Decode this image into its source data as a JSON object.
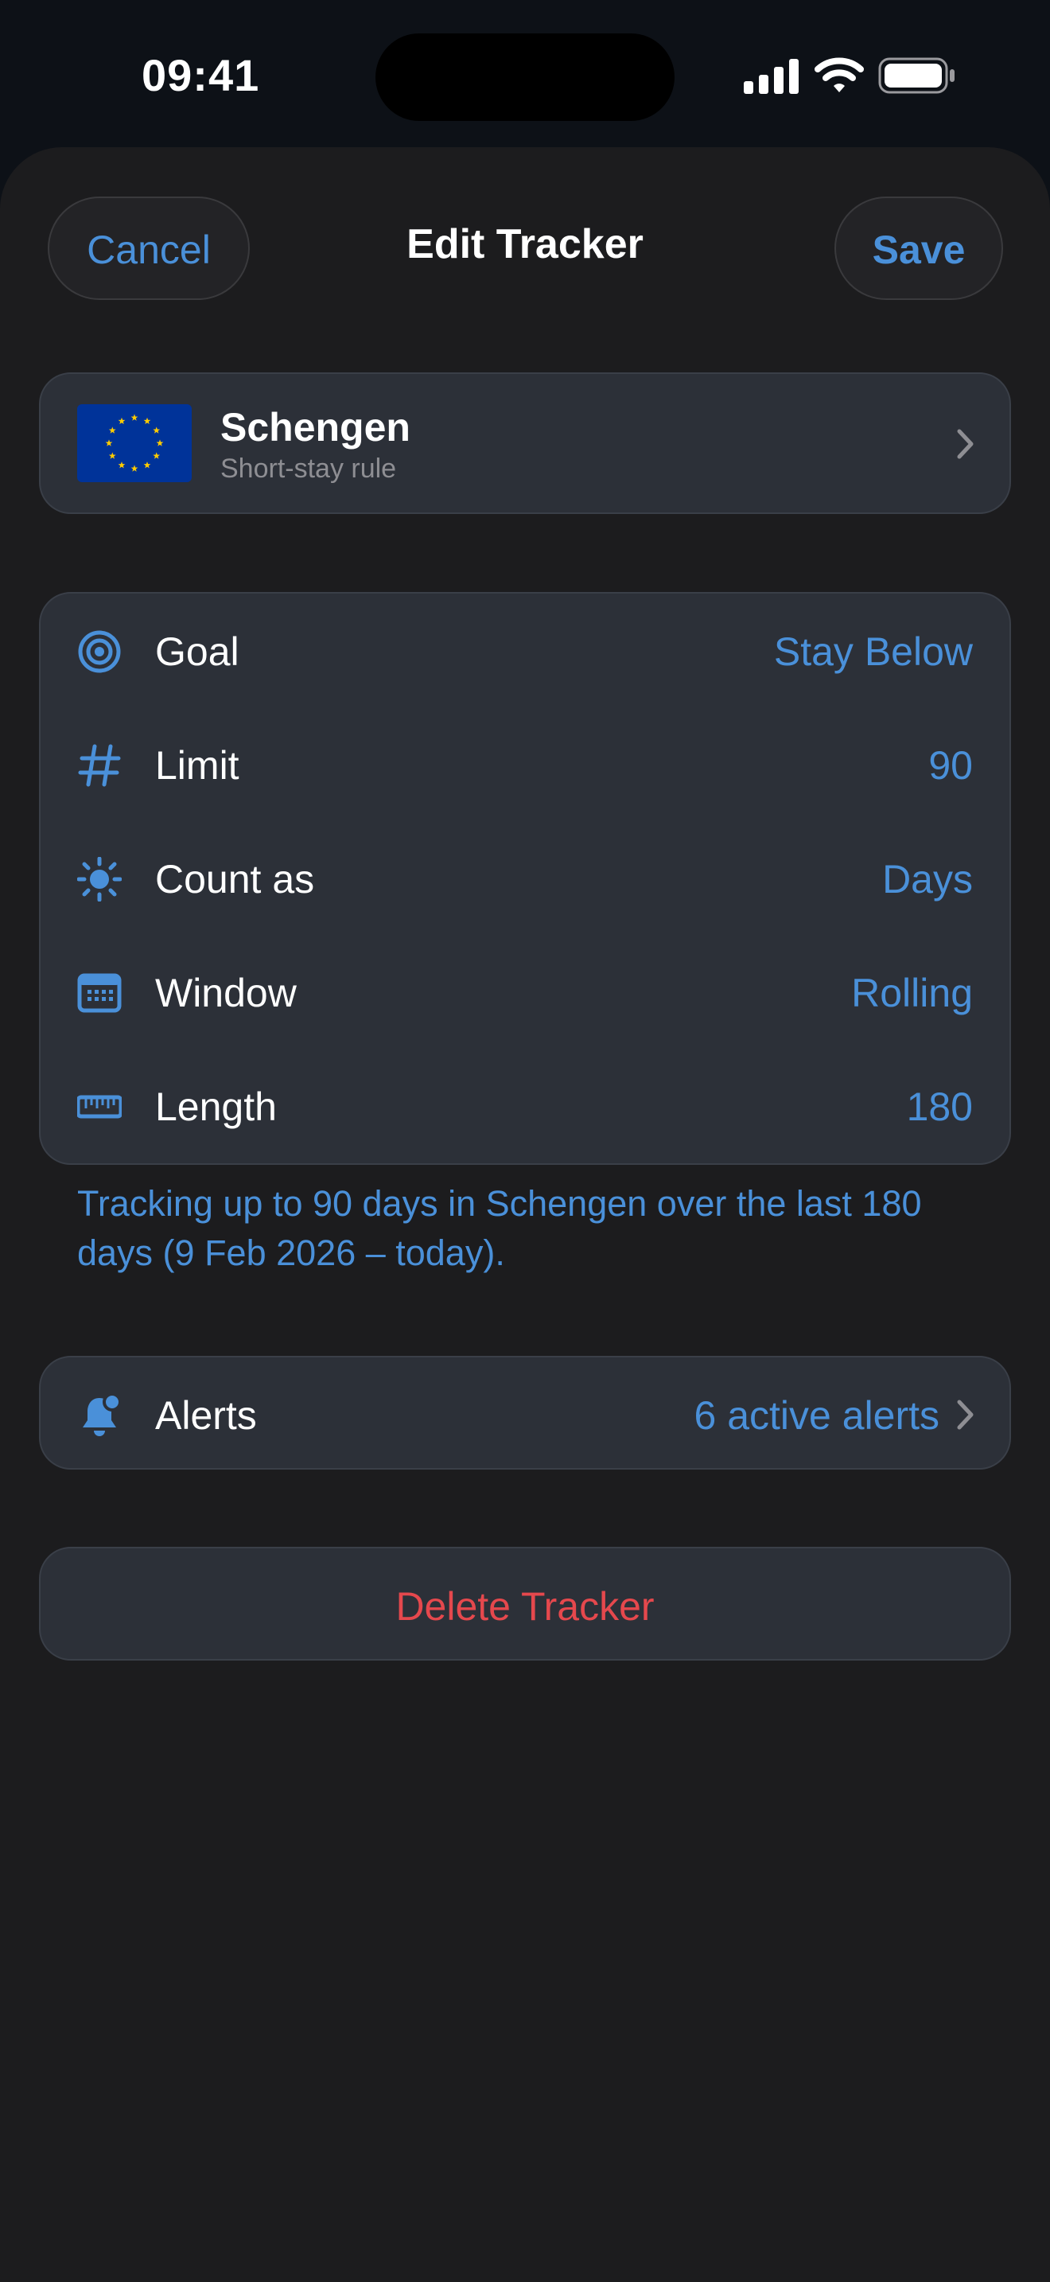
{
  "status_bar": {
    "time": "09:41"
  },
  "header": {
    "cancel_label": "Cancel",
    "title": "Edit Tracker",
    "save_label": "Save"
  },
  "region": {
    "name": "Schengen",
    "subtitle": "Short-stay rule",
    "flag_icon": "eu-flag-icon"
  },
  "settings": [
    {
      "label": "Goal",
      "value": "Stay Below",
      "icon": "target-icon"
    },
    {
      "label": "Limit",
      "value": "90",
      "icon": "hash-icon"
    },
    {
      "label": "Count as",
      "value": "Days",
      "icon": "sun-icon"
    },
    {
      "label": "Window",
      "value": "Rolling",
      "icon": "calendar-icon"
    },
    {
      "label": "Length",
      "value": "180",
      "icon": "ruler-icon"
    }
  ],
  "summary": "Tracking up to 90 days in Schengen over the last 180 days (9 Feb 2026 – today).",
  "alerts": {
    "label": "Alerts",
    "value": "6 active alerts",
    "icon": "bell-badge-icon"
  },
  "delete_label": "Delete Tracker",
  "colors": {
    "accent": "#4a90d9",
    "destructive": "#e5484d",
    "card_background": "#2c3038",
    "sheet_background": "#1c1c1e",
    "flag_blue": "#003399",
    "flag_star": "#ffcc00"
  }
}
